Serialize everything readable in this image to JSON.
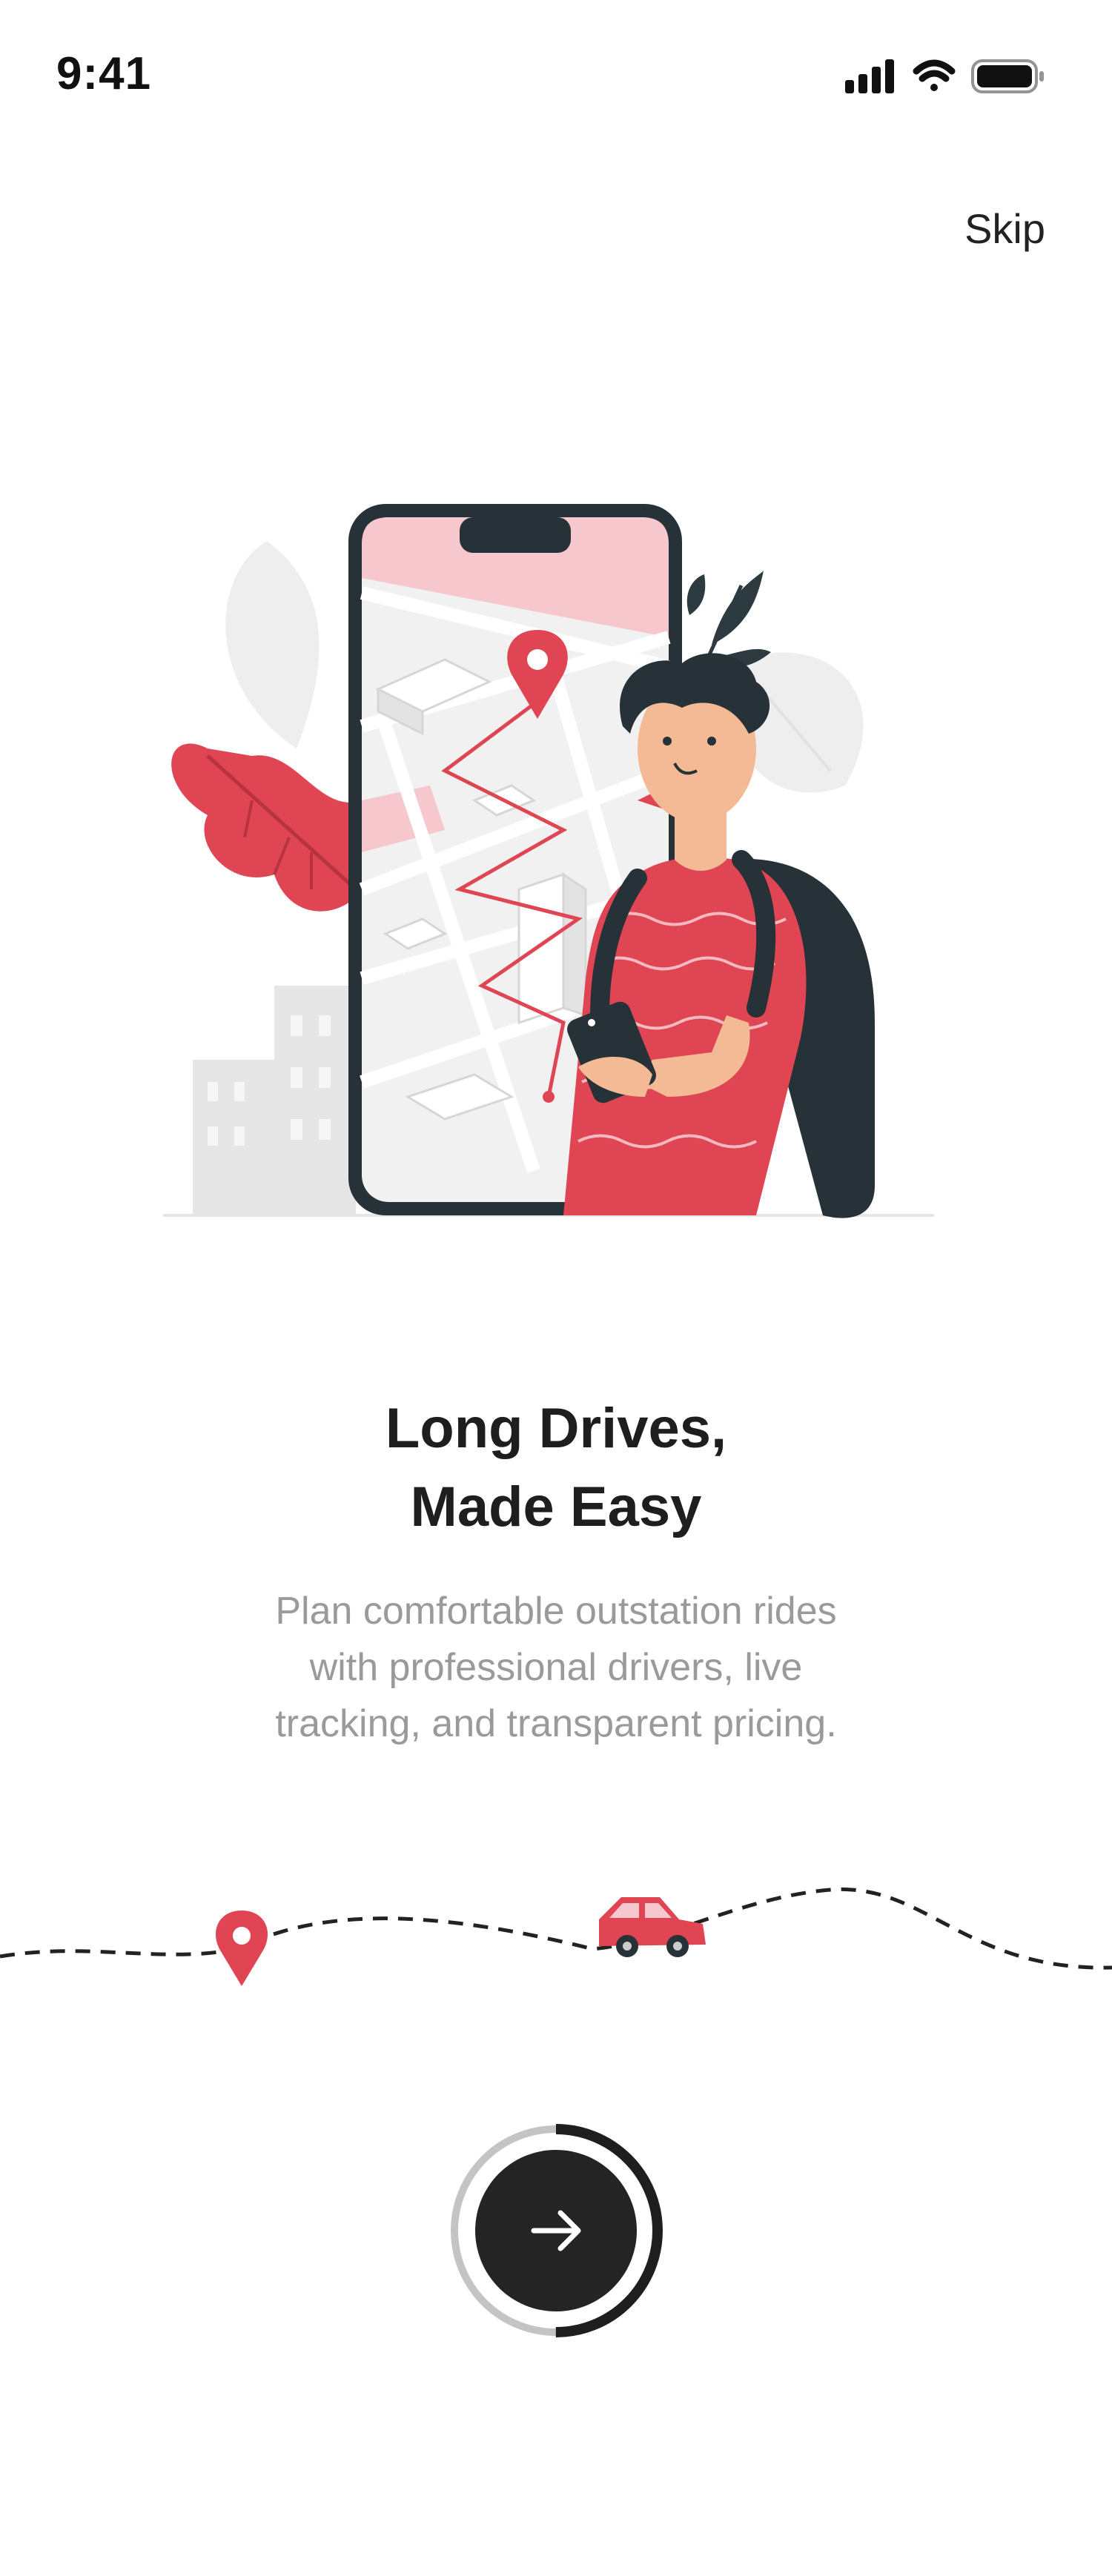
{
  "status_bar": {
    "time": "9:41",
    "icons": [
      "signal-icon",
      "wifi-icon",
      "battery-icon"
    ]
  },
  "header": {
    "skip_label": "Skip"
  },
  "illustration": {
    "description_name": "person-with-phone-map-illustration"
  },
  "onboarding": {
    "title_line1": "Long Drives,",
    "title_line2": "Made Easy",
    "description_line1": "Plan comfortable outstation rides",
    "description_line2": "with professional drivers, live",
    "description_line3": "tracking, and transparent pricing."
  },
  "route": {
    "icons": [
      "location-pin-icon",
      "car-icon"
    ]
  },
  "next_button": {
    "icon": "arrow-right-icon",
    "progress": 0.5
  },
  "colors": {
    "accent": "#e04553",
    "dark": "#242424",
    "muted_text": "#9a9a9a",
    "progress_track": "#c4c4c4"
  }
}
